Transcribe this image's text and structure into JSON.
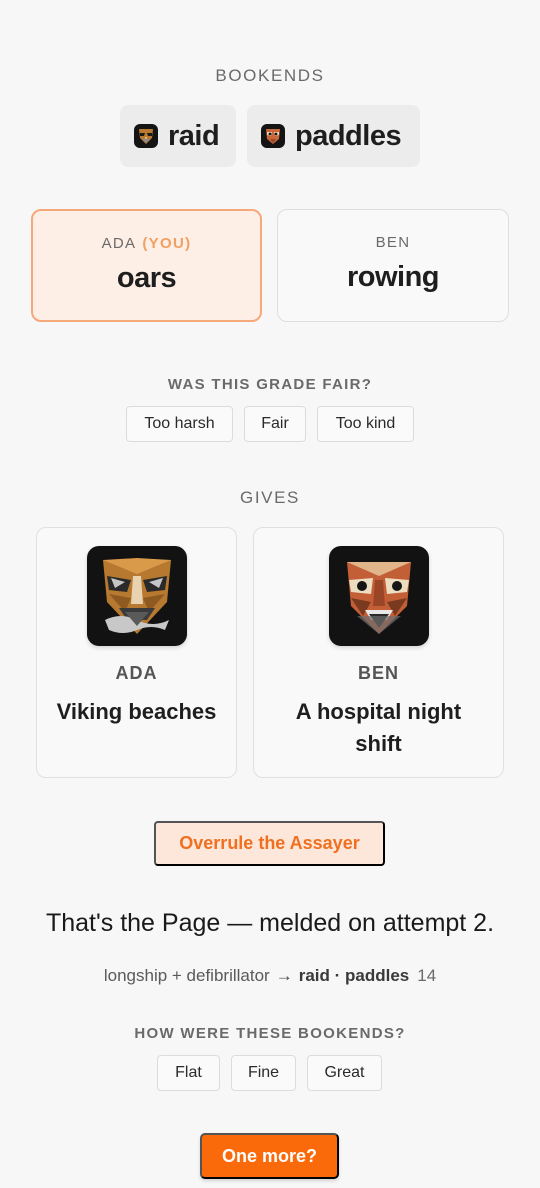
{
  "bookends": {
    "label": "BOOKENDS",
    "words": [
      {
        "text": "raid",
        "icon": "mask-icon"
      },
      {
        "text": "paddles",
        "icon": "mask-icon"
      }
    ]
  },
  "players": {
    "you": {
      "name": "ADA",
      "tag": "(YOU)",
      "word": "oars"
    },
    "other": {
      "name": "BEN",
      "word": "rowing"
    }
  },
  "grade_fair": {
    "label": "WAS THIS GRADE FAIR?",
    "options": [
      "Too harsh",
      "Fair",
      "Too kind"
    ]
  },
  "gives": {
    "label": "GIVES",
    "cards": [
      {
        "name": "ADA",
        "text": "Viking beaches"
      },
      {
        "name": "BEN",
        "text": "A hospital night shift"
      }
    ]
  },
  "overrule_label": "Overrule the Assayer",
  "result": {
    "headline": "That's the Page — melded on attempt 2.",
    "source": "longship + defibrillator",
    "arrow": "→",
    "target": "raid · paddles",
    "score": "14"
  },
  "bookend_rating": {
    "label": "HOW WERE THESE BOOKENDS?",
    "options": [
      "Flat",
      "Fine",
      "Great"
    ]
  },
  "one_more_label": "One more?",
  "colors": {
    "accent": "#fa6a0a",
    "you_card_bg": "#fdeee6",
    "you_card_border": "#f5a97a",
    "background": "#f7f7f7"
  }
}
